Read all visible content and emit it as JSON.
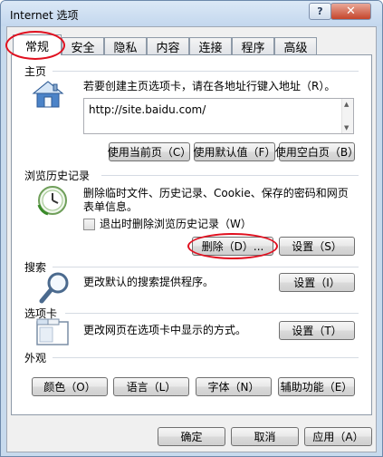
{
  "window": {
    "title": "Internet 选项",
    "help_glyph": "?",
    "close_glyph": "✕"
  },
  "tabs": [
    {
      "label": "常规"
    },
    {
      "label": "安全"
    },
    {
      "label": "隐私"
    },
    {
      "label": "内容"
    },
    {
      "label": "连接"
    },
    {
      "label": "程序"
    },
    {
      "label": "高级"
    }
  ],
  "homepage": {
    "title": "主页",
    "description": "若要创建主页选项卡，请在各地址行键入地址（R）。",
    "url": "http://site.baidu.com/",
    "buttons": {
      "use_current": "使用当前页（C）",
      "use_default": "使用默认值（F）",
      "use_blank": "使用空白页（B）"
    }
  },
  "history": {
    "title": "浏览历史记录",
    "description_line1": "删除临时文件、历史记录、Cookie、保存的密码和网页",
    "description_line2": "表单信息。",
    "checkbox_label": "退出时删除浏览历史记录（W）",
    "buttons": {
      "delete": "删除（D）...",
      "settings": "设置（S）"
    }
  },
  "search": {
    "title": "搜索",
    "description": "更改默认的搜索提供程序。",
    "buttons": {
      "settings": "设置（I）"
    }
  },
  "tabs_section": {
    "title": "选项卡",
    "description": "更改网页在选项卡中显示的方式。",
    "buttons": {
      "settings": "设置（T）"
    }
  },
  "appearance": {
    "title": "外观",
    "buttons": {
      "colors": "颜色（O）",
      "languages": "语言（L）",
      "fonts": "字体（N）",
      "accessibility": "辅助功能（E）"
    }
  },
  "footer": {
    "ok": "确定",
    "cancel": "取消",
    "apply": "应用（A）"
  },
  "colors": {
    "accent_highlight": "#e0101f",
    "title_bar": "#c7daed"
  }
}
